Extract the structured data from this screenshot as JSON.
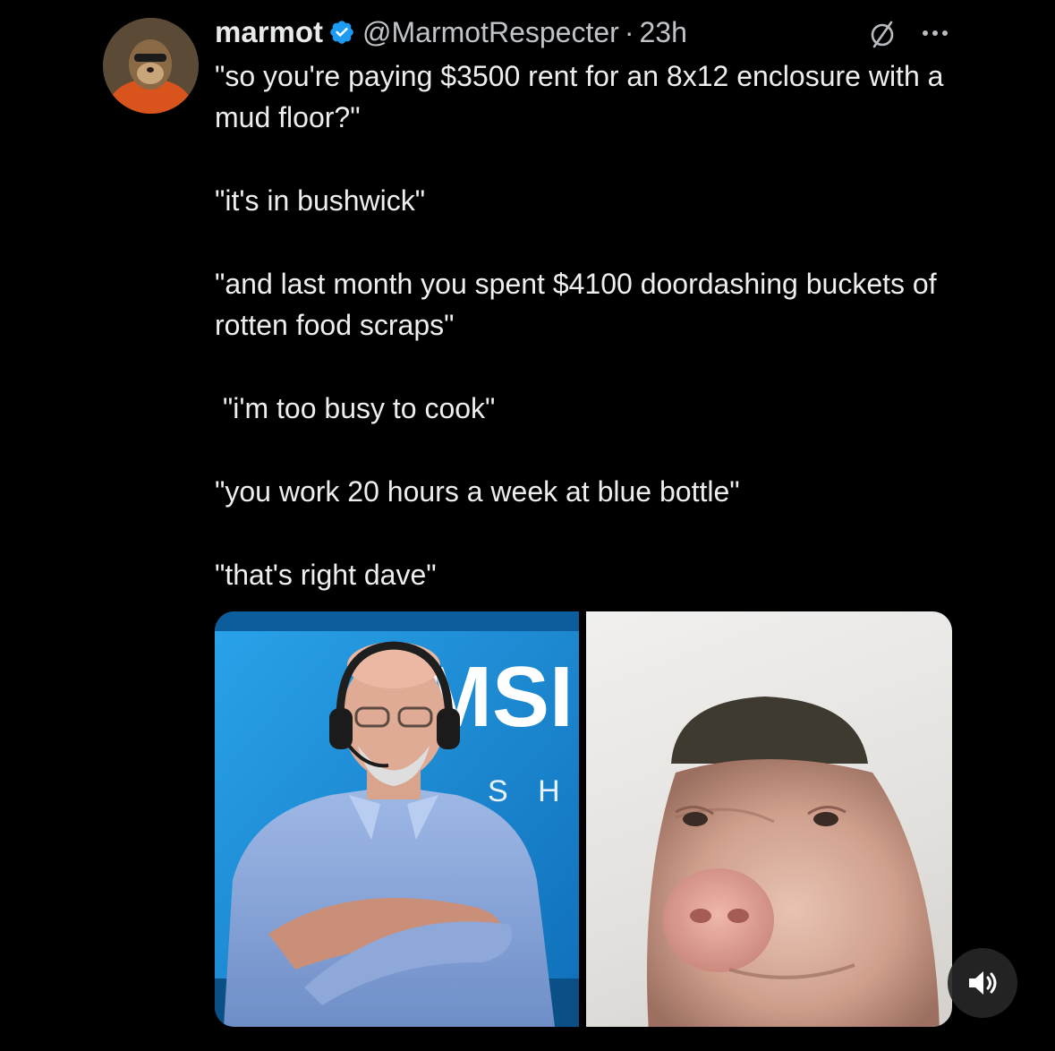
{
  "tweet": {
    "author": {
      "display_name": "marmot",
      "handle": "@MarmotRespecter",
      "verified": true,
      "avatar_icon": "marmot-avatar"
    },
    "separator": "·",
    "time": "23h",
    "paragraphs": [
      "\"so you're paying $3500 rent for an 8x12 enclosure with a mud floor?\"",
      "\"it's in bushwick\"",
      "\"and last month you spent $4100 doordashing buckets of rotten food scraps\"",
      " \"i'm too busy to cook\"",
      "\"you work 20 hours a week at blue bottle\"",
      "\"that's right dave\""
    ],
    "media": {
      "left_image": {
        "subject": "man-with-headset-arms-crossed",
        "backdrop_text_big": "MSI",
        "backdrop_text_small": "S H"
      },
      "right_image": {
        "subject": "pig-with-buzz-cut"
      }
    },
    "icons": {
      "verified": "verified-badge-icon",
      "grok": "grok-icon",
      "more": "more-options-icon",
      "sound": "speaker-icon"
    },
    "colors": {
      "background": "#000000",
      "text": "#e7e9ea",
      "secondary_text": "#c0c4c8",
      "verified_blue": "#1d9bf0",
      "studio_blue": "#1f8fd8"
    }
  }
}
